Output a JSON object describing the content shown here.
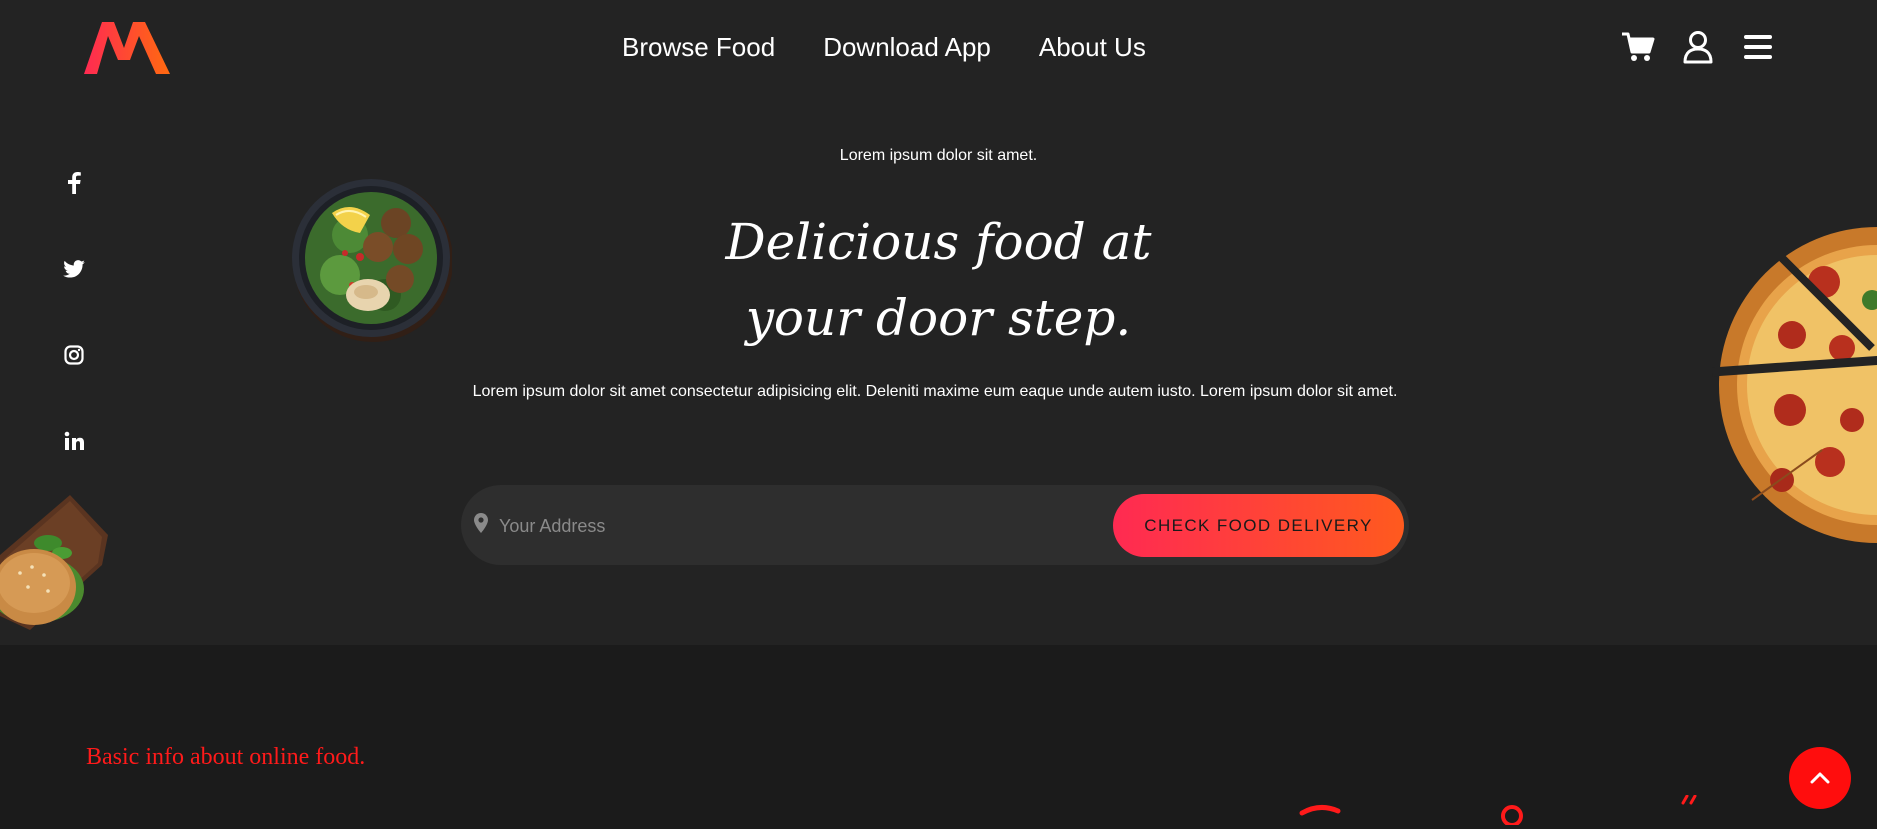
{
  "nav": {
    "links": [
      "Browse Food",
      "Download App",
      "About Us"
    ],
    "icons": [
      "cart-icon",
      "user-icon",
      "menu-icon"
    ]
  },
  "social": [
    "facebook-icon",
    "twitter-icon",
    "instagram-icon",
    "linkedin-icon"
  ],
  "hero": {
    "tagline": "Lorem ipsum dolor sit amet.",
    "headline_line1": "Delicious food at",
    "headline_line2": "your door step.",
    "description": "Lorem ipsum dolor sit amet consectetur adipisicing elit. Deleniti maxime eum eaque unde autem iusto. Lorem ipsum dolor sit amet.",
    "address_placeholder": "Your Address",
    "button_label": "CHECK FOOD DELIVERY"
  },
  "info": {
    "title": "Basic info about online food."
  },
  "colors": {
    "accent_start": "#ff2a52",
    "accent_end": "#ff5a1e",
    "back_to_top": "#ff0d0d",
    "hero_bg": "#232323",
    "page_bg": "#1b1b1b"
  }
}
